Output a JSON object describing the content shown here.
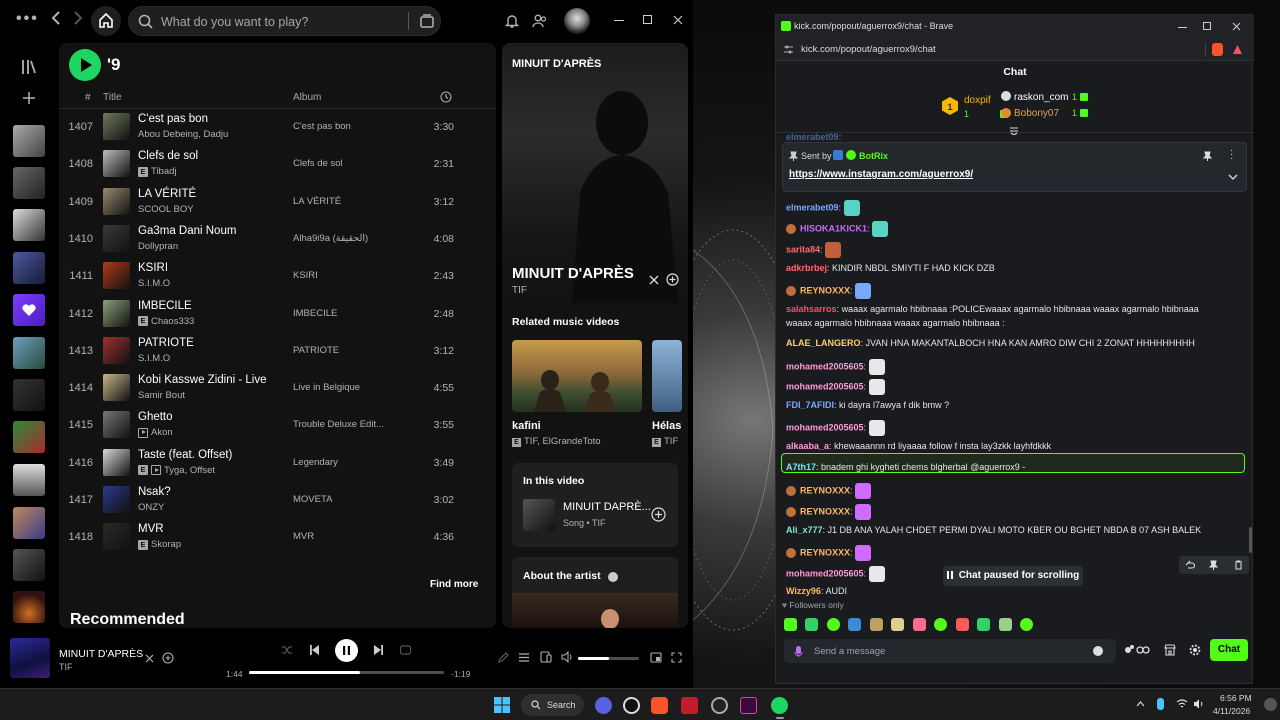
{
  "spotify": {
    "search": {
      "placeholder": "What do you want to play?"
    },
    "playlist_title": "'9",
    "columns": {
      "num": "#",
      "title": "Title",
      "album": "Album"
    },
    "tracks": [
      {
        "num": "1407",
        "title": "C'est pas bon",
        "artist": "Abou Debeing, Dadju",
        "explicit": false,
        "video": false,
        "album": "C'est pas bon",
        "duration": "3:30",
        "art": "#6f7a5a"
      },
      {
        "num": "1408",
        "title": "Clefs de sol",
        "artist": "Tibadj",
        "explicit": true,
        "video": false,
        "album": "Clefs de sol",
        "duration": "2:31",
        "art": "#bdbdbd"
      },
      {
        "num": "1409",
        "title": "LA VÉRITÉ",
        "artist": "SCOOL BOY",
        "explicit": false,
        "video": false,
        "album": "LA VÉRITÉ",
        "duration": "3:12",
        "art": "#9a8a70"
      },
      {
        "num": "1410",
        "title": "Ga3ma Dani Noum",
        "artist": "Dollypran",
        "explicit": false,
        "video": false,
        "album": "Alha9i9a (الحقيقة)",
        "duration": "4:08",
        "art": "#3a3a3a"
      },
      {
        "num": "1411",
        "title": "KSIRI",
        "artist": "S.I.M.O",
        "explicit": false,
        "video": false,
        "album": "KSIRI",
        "duration": "2:43",
        "art": "#b03a1a"
      },
      {
        "num": "1412",
        "title": "IMBECILE",
        "artist": "Chaos333",
        "explicit": true,
        "video": false,
        "album": "IMBECILE",
        "duration": "2:48",
        "art": "#8aa07a"
      },
      {
        "num": "1413",
        "title": "PATRIOTE",
        "artist": "S.I.M.O",
        "explicit": false,
        "video": false,
        "album": "PATRIOTE",
        "duration": "3:12",
        "art": "#a03030"
      },
      {
        "num": "1414",
        "title": "Kobi Kasswe Zidini - Live",
        "artist": "Samir Bout",
        "explicit": false,
        "video": false,
        "album": "Live in Belgique",
        "duration": "4:55",
        "art": "#c9b48a"
      },
      {
        "num": "1415",
        "title": "Ghetto",
        "artist": "Akon",
        "explicit": false,
        "video": true,
        "album": "Trouble Deluxe Edit...",
        "duration": "3:55",
        "art": "#777"
      },
      {
        "num": "1416",
        "title": "Taste (feat. Offset)",
        "artist": "Tyga, Offset",
        "explicit": true,
        "video": true,
        "album": "Legendary",
        "duration": "3:49",
        "art": "#d8d8d8"
      },
      {
        "num": "1417",
        "title": "Nsak?",
        "artist": "ONZY",
        "explicit": false,
        "video": false,
        "album": "MOVETA",
        "duration": "3:02",
        "art": "#2a3a8a"
      },
      {
        "num": "1418",
        "title": "MVR",
        "artist": "Skorap",
        "explicit": true,
        "video": false,
        "album": "MVR",
        "duration": "4:36",
        "art": "#2a2a2a"
      }
    ],
    "find_more": "Find more",
    "recommended": "Recommended",
    "now_playing_panel": {
      "header": "MINUIT D'APRÈS",
      "title": "MINUIT D'APRÈS",
      "artist": "TIF",
      "related_label": "Related music videos",
      "videos": [
        {
          "title": "kafini",
          "artists": "TIF, ElGrandeToto"
        },
        {
          "title": "Hélas",
          "artists": "TIF"
        }
      ],
      "in_this_video_label": "In this video",
      "in_video_title": "MINUIT DAPRÈ...",
      "in_video_sub": "Song • TIF",
      "about_artist": "About the artist"
    },
    "player": {
      "title": "MINUIT D'APRÈS",
      "artist": "TIF",
      "elapsed": "1:44",
      "remaining": "-1:19",
      "progress": 0.57,
      "volume": 0.5
    }
  },
  "brave": {
    "title": "kick.com/popout/aguerrox9/chat - Brave",
    "url": "kick.com/popout/aguerrox9/chat",
    "chat_header": "Chat",
    "leaderboard": [
      {
        "rank": "1",
        "name": "doxpif",
        "count": "1"
      },
      {
        "name": "raskon_com",
        "count": "1"
      },
      {
        "name": "Bobony07",
        "count": "1"
      }
    ],
    "pinned": {
      "sent_by": "Sent by",
      "bot": "BotRix",
      "link": "https://www.instagram.com/aguerrox9/"
    },
    "messages": [
      {
        "user": "elmerabet09",
        "color": "#7aa8ff",
        "text": "",
        "emote": "#5ad1c5"
      },
      {
        "user": "HISOKA1KICK1",
        "color": "#c36bff",
        "text": "",
        "emote": "#5ad1c5",
        "badge": true
      },
      {
        "user": "sarita84",
        "color": "#ff6b6b",
        "text": "",
        "emote": "#c0603a"
      },
      {
        "user": "adkrbrbej",
        "color": "#ff6b6b",
        "text": "KINDIR NBDL SMIYTI F HAD KICK DZB"
      },
      {
        "user": "REYNOXXX",
        "color": "#ffb86b",
        "text": "",
        "emote": "#7aa8ff",
        "badge": true
      },
      {
        "user": "salahsarros",
        "color": "#ff4d6d",
        "text": "waaax agarmalo hbibnaaa :POLICEwaaax agarmalo hbibnaaa  waaax agarmalo hbibnaaa"
      },
      {
        "user": "",
        "color": "#ffffff",
        "text": "waaax agarmalo hbibnaaa   waaax agarmalo hbibnaaa   :"
      },
      {
        "user": "ALAE_LANGERO",
        "color": "#ffd166",
        "text": "JVAN HNA MAKANTALBOCH HNA KAN AMRO DIW CHI 2 ZONAT HHHHHHHHH"
      },
      {
        "user": "mohamed2005605",
        "color": "#ff9ad5",
        "text": "",
        "emote": "#e8e8e8"
      },
      {
        "user": "mohamed2005605",
        "color": "#ff9ad5",
        "text": "",
        "emote": "#e8e8e8"
      },
      {
        "user": "FDI_7AFIDI",
        "color": "#7aa8ff",
        "text": "ki dayra l7awya f dik bmw ?"
      },
      {
        "user": "mohamed2005605",
        "color": "#ff9ad5",
        "text": "",
        "emote": "#e8e8e8"
      },
      {
        "user": "alkaaba_a",
        "color": "#ff9ad5",
        "text": "khewaaannn rd liyaaaa follow f insta lay3zkk  layhfdkkk"
      },
      {
        "user": "A7th17",
        "color": "#7ee0ff",
        "text": "bnadem ghi kygheti chems blgherbal @aguerrox9 -"
      },
      {
        "user": "REYNOXXX",
        "color": "#ffb86b",
        "text": "",
        "emote": "#d06bff",
        "badge": true
      },
      {
        "user": "REYNOXXX",
        "color": "#ffb86b",
        "text": "",
        "emote": "#d06bff",
        "badge": true
      },
      {
        "user": "Ali_x777",
        "color": "#7ef0c8",
        "text": "J1 DB ANA YALAH CHDET PERMI DYALI MOTO KBER OU BGHET NBDA B 07 ASH BALEK"
      },
      {
        "user": "REYNOXXX",
        "color": "#ffb86b",
        "text": "",
        "emote": "#d06bff",
        "badge": true
      },
      {
        "user": "mohamed2005605",
        "color": "#ff9ad5",
        "text": "",
        "emote": "#e8e8e8"
      },
      {
        "user": "Wizzy96",
        "color": "#ffb86b",
        "text": "AUDI"
      }
    ],
    "paused_label": "Chat paused for scrolling",
    "followers_only": "Followers only",
    "input_placeholder": "Send a message",
    "chat_button": "Chat"
  },
  "taskbar": {
    "search_label": "Search",
    "time": "6:56 PM",
    "date": "4/11/2026"
  },
  "colors": {
    "spotify_green": "#1ed760",
    "kick_green": "#53fc18"
  }
}
